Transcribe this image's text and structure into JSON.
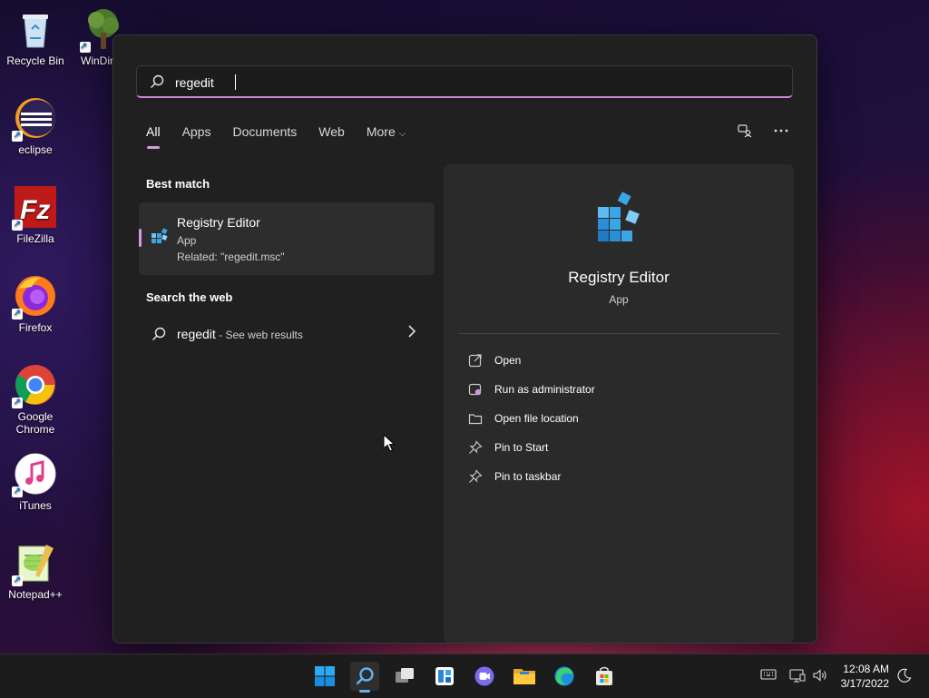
{
  "desktop": {
    "icons": [
      {
        "label": "Recycle Bin"
      },
      {
        "label": "WinDir"
      },
      {
        "label": "eclipse"
      },
      {
        "label": "FileZilla"
      },
      {
        "label": "Firefox"
      },
      {
        "label": "Google Chrome"
      },
      {
        "label": "iTunes"
      },
      {
        "label": "Notepad++"
      }
    ]
  },
  "search": {
    "query": "regedit",
    "tabs": [
      "All",
      "Apps",
      "Documents",
      "Web",
      "More"
    ],
    "active_tab": "All",
    "best_match_title": "Best match",
    "best_match": {
      "name": "Registry Editor",
      "type": "App",
      "related": "Related: \"regedit.msc\""
    },
    "web_title": "Search the web",
    "web_result": {
      "term": "regedit",
      "hint": " - See web results"
    }
  },
  "preview": {
    "name": "Registry Editor",
    "type": "App",
    "actions": [
      {
        "label": "Open",
        "icon": "open-icon"
      },
      {
        "label": "Run as administrator",
        "icon": "admin-icon"
      },
      {
        "label": "Open file location",
        "icon": "folder-icon"
      },
      {
        "label": "Pin to Start",
        "icon": "pin-icon"
      },
      {
        "label": "Pin to taskbar",
        "icon": "pin-icon"
      }
    ]
  },
  "taskbar": {
    "apps": [
      "start",
      "search",
      "task-view",
      "widgets",
      "chat",
      "file-explorer",
      "edge",
      "store"
    ],
    "clock_time": "12:08 AM",
    "clock_date": "3/17/2022"
  },
  "colors": {
    "accent": "#d59be0",
    "panel": "#202020",
    "taskbar": "#1c1c1c"
  }
}
